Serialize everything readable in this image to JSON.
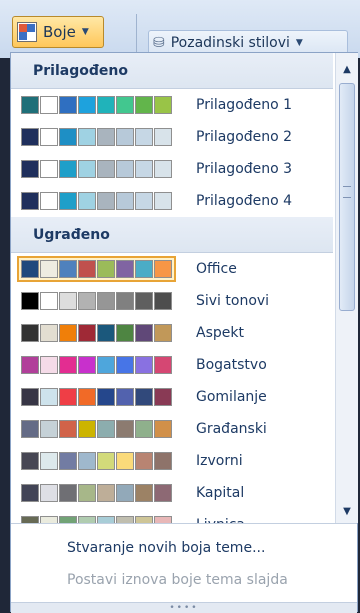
{
  "ribbon": {
    "colors_button_label": "Boje",
    "background_styles_label": "Pozadinski stilovi"
  },
  "sections": [
    {
      "title": "Prilagođeno",
      "items": [
        {
          "label": "Prilagođeno 1",
          "swatches": [
            "#1f6f78",
            "#ffffff",
            "#2f6fc1",
            "#1ea2dd",
            "#20b3ba",
            "#42c78f",
            "#62b54b",
            "#99c447"
          ]
        },
        {
          "label": "Prilagođeno 2",
          "swatches": [
            "#1f2f5c",
            "#ffffff",
            "#1e8fc5",
            "#9fd2e3",
            "#a9b4be",
            "#b7c9d9",
            "#c6d7e5",
            "#d8e3ea"
          ]
        },
        {
          "label": "Prilagođeno 3",
          "swatches": [
            "#1f2f5c",
            "#ffffff",
            "#1e9fc9",
            "#9fd2e3",
            "#a9b4be",
            "#b7c9d9",
            "#c6d7e5",
            "#d8e3ea"
          ]
        },
        {
          "label": "Prilagođeno 4",
          "swatches": [
            "#1f2f5c",
            "#ffffff",
            "#1e9fc9",
            "#9fd2e3",
            "#a9b4be",
            "#b7c9d9",
            "#c6d7e5",
            "#d8e3ea"
          ]
        }
      ]
    },
    {
      "title": "Ugrađeno",
      "items": [
        {
          "label": "Office",
          "selected": true,
          "swatches": [
            "#1f497d",
            "#eeece1",
            "#4f81bd",
            "#c0504d",
            "#9bbb59",
            "#8064a2",
            "#4bacc6",
            "#f79646"
          ]
        },
        {
          "label": "Sivi tonovi",
          "swatches": [
            "#000000",
            "#ffffff",
            "#dddddd",
            "#b2b2b2",
            "#969696",
            "#808080",
            "#5f5f5f",
            "#4d4d4d"
          ]
        },
        {
          "label": "Aspekt",
          "swatches": [
            "#323232",
            "#e3ded1",
            "#f07f09",
            "#9f2936",
            "#1b587c",
            "#4e8542",
            "#604878",
            "#c19859"
          ]
        },
        {
          "label": "Bogatstvo",
          "swatches": [
            "#b13f9a",
            "#f5dbe8",
            "#e32d91",
            "#c830cc",
            "#4ea6dc",
            "#4775e7",
            "#8971e1",
            "#d54773"
          ]
        },
        {
          "label": "Gomilanje",
          "swatches": [
            "#373545",
            "#cee3ec",
            "#ef3e46",
            "#f16a27",
            "#25478c",
            "#5262ae",
            "#31497b",
            "#893a55"
          ]
        },
        {
          "label": "Građanski",
          "swatches": [
            "#646b86",
            "#c5d1d7",
            "#d16349",
            "#ccb400",
            "#8cadae",
            "#8c7b70",
            "#8fb08c",
            "#d19049"
          ]
        },
        {
          "label": "Izvorni",
          "swatches": [
            "#464653",
            "#dde9ec",
            "#727ca3",
            "#9fb8cd",
            "#d2da7a",
            "#fada7a",
            "#b88472",
            "#8e736a"
          ]
        },
        {
          "label": "Kapital",
          "swatches": [
            "#424456",
            "#dedfe5",
            "#6f6f74",
            "#a7b789",
            "#beae98",
            "#92a9b9",
            "#9c8265",
            "#8d6974"
          ]
        },
        {
          "label": "Livnica",
          "swatches": [
            "#676a55",
            "#eaebde",
            "#72a376",
            "#b0ccb0",
            "#a8cdd7",
            "#c0beaf",
            "#cec597",
            "#e8b7b7"
          ]
        }
      ]
    }
  ],
  "footer": {
    "create_label": "Stvaranje novih boja teme...",
    "reset_label": "Postavi iznova boje tema slajda"
  },
  "icons": {
    "scroll_up": "triangle-up-icon",
    "scroll_down": "triangle-down-icon"
  }
}
